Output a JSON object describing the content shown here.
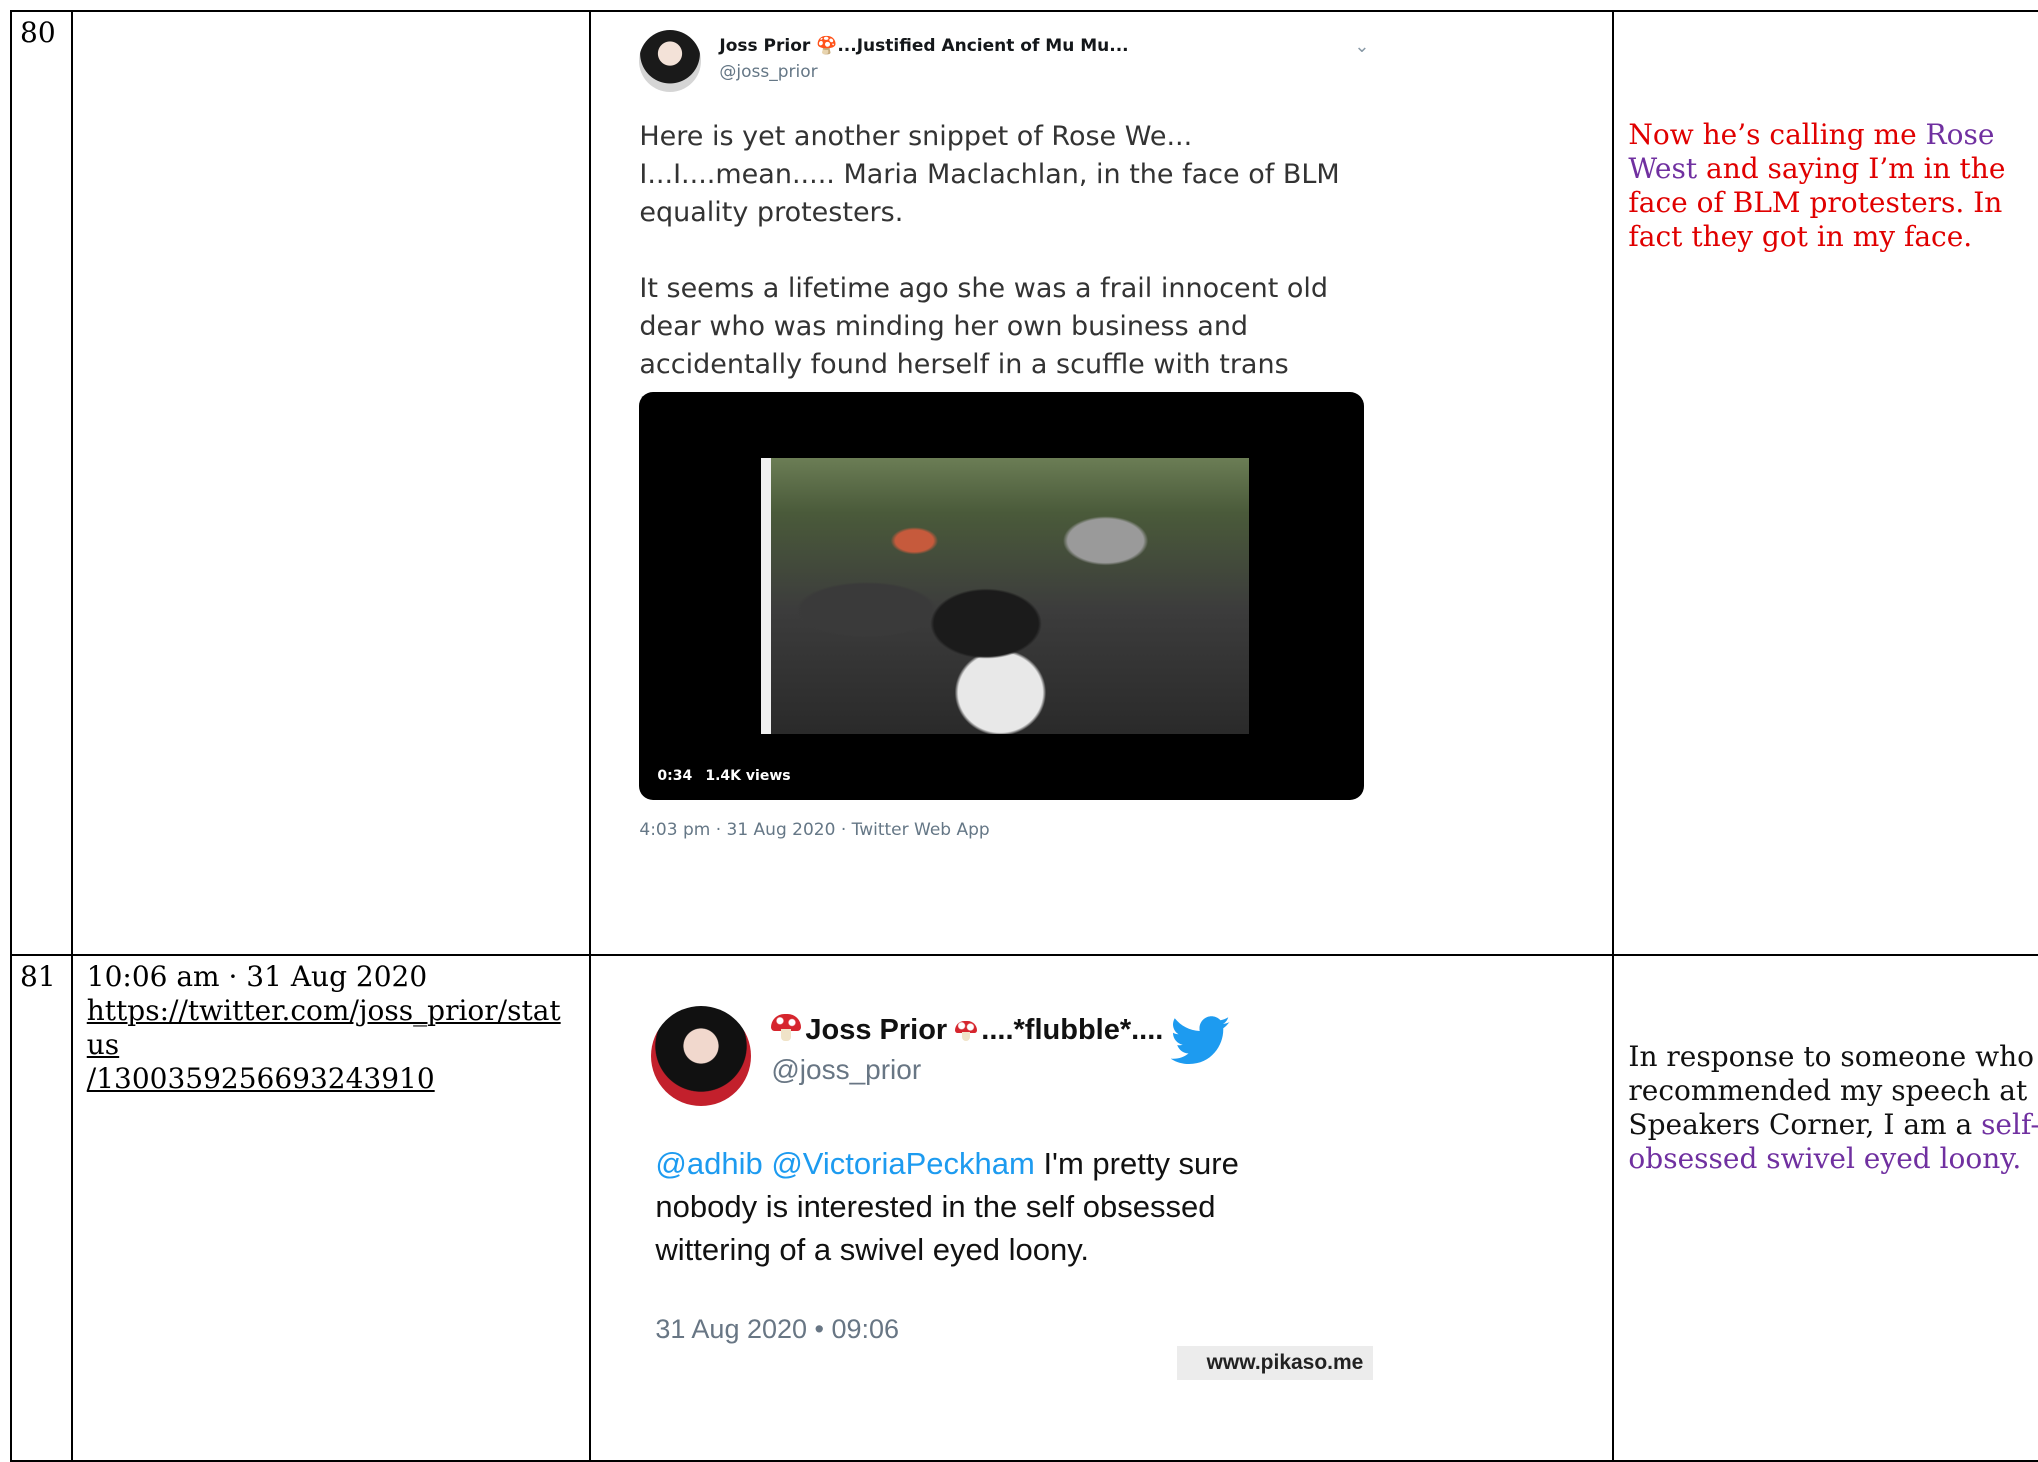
{
  "rows": [
    {
      "number": "80",
      "date": "",
      "url_line1": "",
      "url_line2": "",
      "tweet": {
        "display_name": "Joss Prior 🍄...Justified Ancient of Mu Mu...",
        "handle": "@joss_prior",
        "paragraph1": "Here is yet another snippet of Rose We... I...I....mean..... Maria Maclachlan, in the face of BLM equality protesters.",
        "paragraph2": "It seems a lifetime ago she was a frail innocent old dear who  was minding her own business and accidentally found herself in a scuffle with trans protesters..",
        "video_duration": "0:34",
        "video_views": "1.4K views",
        "meta": "4:03 pm · 31 Aug 2020 · Twitter Web App"
      },
      "comment": {
        "part1": "Now he’s calling me ",
        "highlight": "Rose West",
        "part2": " and saying I’m in the face of BLM protesters. In fact they got in my face."
      }
    },
    {
      "number": "81",
      "date": "10:06 am · 31 Aug 2020",
      "url_line1": "https://twitter.com/joss_prior/status",
      "url_line2": "/1300359256693243910",
      "tweet": {
        "display_name": "Joss Prior",
        "name_suffix": "....*flubble*....",
        "handle": "@joss_prior",
        "mention1": "@adhib",
        "mention2": "@VictoriaPeckham",
        "body": " I'm pretty sure nobody is interested in the self obsessed wittering of a swivel eyed loony.",
        "time": "31 Aug 2020 • 09:06",
        "watermark": "www.pikaso.me"
      },
      "comment": {
        "part1": "In response to someone who recommended my speech at Speakers Corner, I am a ",
        "highlight": "self-obsessed swivel eyed loony."
      }
    }
  ],
  "icons": {
    "tweet1_menu": "chevron-down-icon",
    "tweet2_logo": "twitter-bird-icon",
    "name_emoji": "mushroom-icon"
  },
  "colors": {
    "comment_red": "#e00000",
    "highlight_purple": "#7030a0",
    "twitter_blue": "#1d9bf0"
  }
}
